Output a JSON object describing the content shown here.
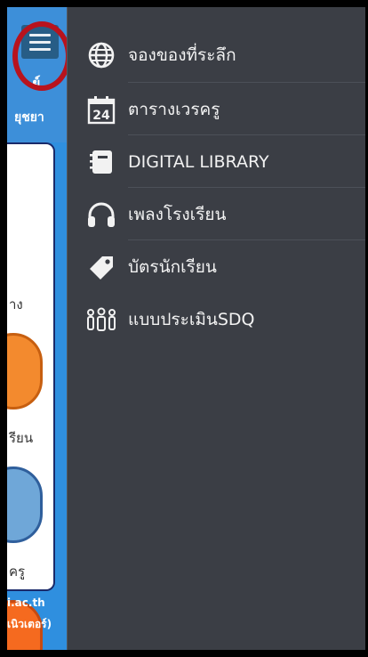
{
  "background_app": {
    "title_fragment": "ย์",
    "subtitle_fragment": "ยุชยา",
    "tile_labels": [
      "าง",
      "รียน",
      "ครู"
    ],
    "footer_line1": "i.ac.th",
    "footer_line2": "เนิวเตอร์)"
  },
  "menu_button": {
    "icon": "hamburger-icon"
  },
  "drawer": {
    "items": [
      {
        "label": "จองของที่ระลึก",
        "icon": "globe-icon"
      },
      {
        "label": "ตารางเวรครู",
        "icon": "calendar-icon",
        "icon_text": "24"
      },
      {
        "label": "DIGITAL LIBRARY",
        "icon": "book-icon"
      },
      {
        "label": "เพลงโรงเรียน",
        "icon": "headphones-icon"
      },
      {
        "label": "บัตรนักเรียน",
        "icon": "tag-icon"
      },
      {
        "label": "แบบประเมินSDQ",
        "icon": "people-icon"
      }
    ]
  }
}
